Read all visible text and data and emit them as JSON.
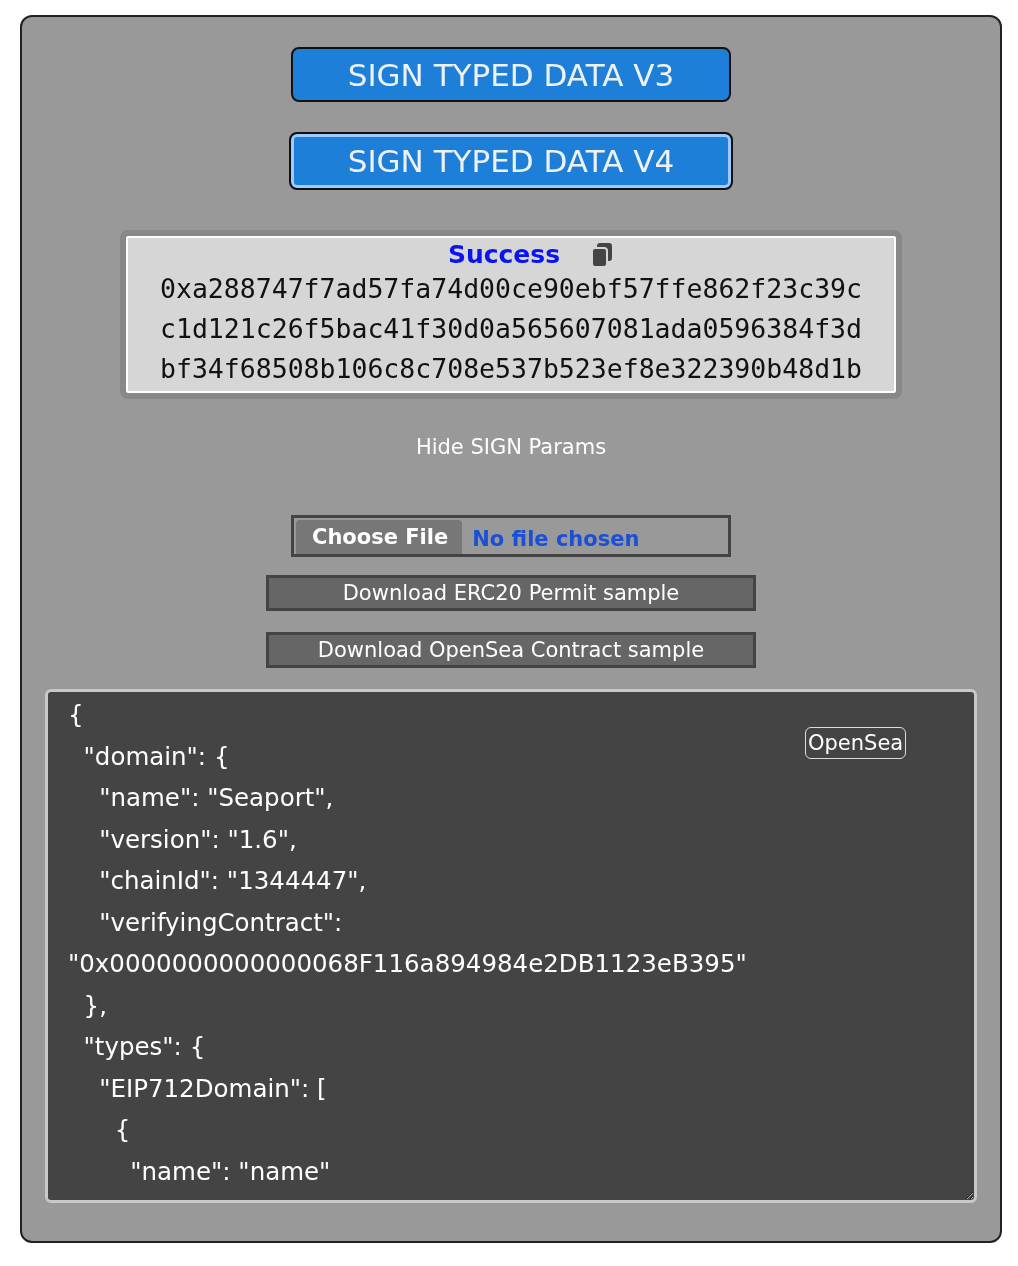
{
  "sign_buttons": [
    {
      "label": "SIGN TYPED DATA V3",
      "focused": false
    },
    {
      "label": "SIGN TYPED DATA V4",
      "focused": true
    }
  ],
  "result": {
    "status": "Success",
    "signature_lines": [
      "0xa288747f7ad57fa74d00ce90ebf57ffe862f23c39c",
      "c1d121c26f5bac41f30d0a565607081ada0596384f3d",
      "bf34f68508b106c8c708e537b523ef8e322390b48d1b"
    ]
  },
  "toggle_link": "Hide SIGN Params",
  "file_input": {
    "button": "Choose File",
    "status": "No file chosen"
  },
  "download_buttons": [
    "Download ERC20 Permit sample",
    "Download OpenSea Contract sample"
  ],
  "editor": {
    "badge": "OpenSea",
    "lines": [
      "{",
      "  \"domain\": {",
      "    \"name\": \"Seaport\",",
      "    \"version\": \"1.6\",",
      "    \"chainId\": \"1344447\",",
      "    \"verifyingContract\":",
      "\"0x0000000000000068F116a894984e2DB1123eB395\"",
      "  },",
      "  \"types\": {",
      "    \"EIP712Domain\": [",
      "      {",
      "        \"name\": \"name\""
    ]
  }
}
